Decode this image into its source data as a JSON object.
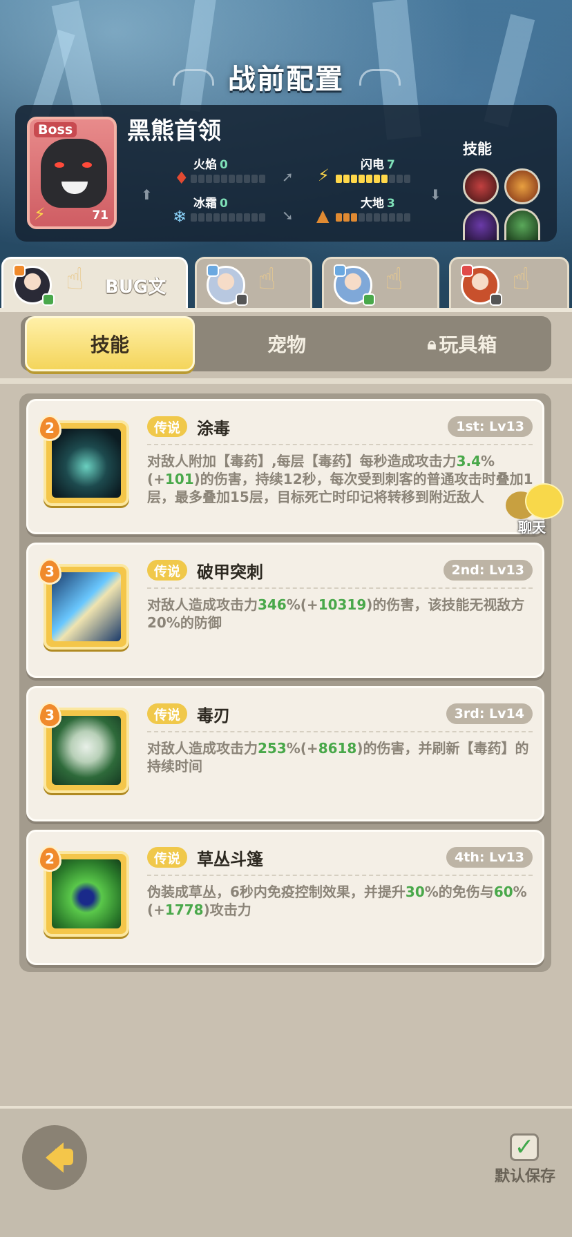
{
  "page": {
    "title": "战前配置"
  },
  "boss": {
    "tag": "Boss",
    "name": "黑熊首领",
    "level": "71",
    "skills_title": "技能",
    "elements": {
      "fire": {
        "label": "火焰",
        "value": "0",
        "level": 0,
        "max": 10
      },
      "lightning": {
        "label": "闪电",
        "value": "7",
        "level": 7,
        "max": 10
      },
      "frost": {
        "label": "冰霜",
        "value": "0",
        "level": 0,
        "max": 10
      },
      "earth": {
        "label": "大地",
        "value": "3",
        "level": 3,
        "max": 10
      }
    }
  },
  "characters": [
    {
      "name": "BUG文",
      "active": true
    },
    {
      "name": "",
      "active": false
    },
    {
      "name": "",
      "active": false
    },
    {
      "name": "",
      "active": false
    }
  ],
  "tabs": {
    "skills": "技能",
    "pets": "宠物",
    "toybox": "玩具箱",
    "active": "skills"
  },
  "skills": [
    {
      "rank": "2",
      "rarity": "传说",
      "name": "涂毒",
      "slot": "1st: Lv13",
      "desc": [
        "对敌人附加【毒药】,每层【毒药】每秒造成攻击力",
        {
          "hl": "3.4"
        },
        "%(+",
        {
          "hl": "101"
        },
        ")的伤害，持续12秒，每次受到刺客的普通攻击时叠加1层，最多叠加15层，目标死亡时印记将转移到附近敌人"
      ]
    },
    {
      "rank": "3",
      "rarity": "传说",
      "name": "破甲突刺",
      "slot": "2nd: Lv13",
      "desc": [
        "对敌人造成攻击力",
        {
          "hl": "346"
        },
        "%(+",
        {
          "hl": "10319"
        },
        ")的伤害，该技能无视敌方20%的防御"
      ]
    },
    {
      "rank": "3",
      "rarity": "传说",
      "name": "毒刃",
      "slot": "3rd: Lv14",
      "desc": [
        "对敌人造成攻击力",
        {
          "hl": "253"
        },
        "%(+",
        {
          "hl": "8618"
        },
        ")的伤害，并刷新【毒药】的持续时间"
      ]
    },
    {
      "rank": "2",
      "rarity": "传说",
      "name": "草丛斗篷",
      "slot": "4th: Lv13",
      "desc": [
        "伪装成草丛，6秒内免疫控制效果，并提升",
        {
          "hl": "30"
        },
        "%的免伤与",
        {
          "hl": "60"
        },
        "%(+",
        {
          "hl": "1778"
        },
        ")攻击力"
      ]
    }
  ],
  "chat": {
    "label": "聊天"
  },
  "footer": {
    "save_label": "默认保存"
  },
  "colors": {
    "accent": "#f4c64a",
    "highlight": "#49a84a",
    "panel": "#16243a"
  }
}
